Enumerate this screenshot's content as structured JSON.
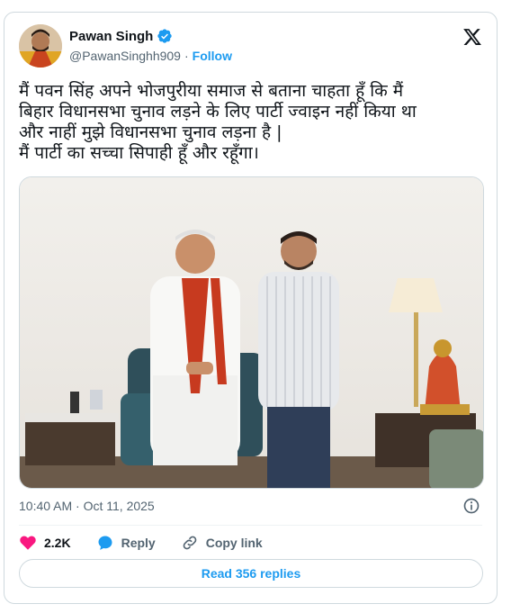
{
  "author": {
    "name": "Pawan Singh",
    "handle": "@PawanSinghh909",
    "separator": "·",
    "follow_label": "Follow"
  },
  "tweet": {
    "lines": [
      "मैं पवन सिंह अपने भोजपुरीया समाज से बताना चाहता हूँ कि मैं",
      "बिहार विधानसभा चुनाव लड़ने के लिए पार्टी ज्वाइन नहीं किया था",
      "और नाहीं मुझे विधानसभा चुनाव लड़ना है |",
      "मैं पार्टी का सच्चा सिपाही हूँ और रहूँगा।"
    ]
  },
  "meta": {
    "timestamp": "10:40 AM · Oct 11, 2025"
  },
  "actions": {
    "likes_count": "2.2K",
    "reply_label": "Reply",
    "copy_link_label": "Copy link"
  },
  "read_replies_label": "Read 356 replies",
  "colors": {
    "accent": "#1d9bf0",
    "like": "#f91880",
    "text": "#0f1419",
    "secondary": "#536471",
    "border": "#cfd9de"
  },
  "icons": [
    "verified-badge-icon",
    "x-logo-icon",
    "info-icon",
    "heart-icon",
    "reply-bubble-icon",
    "link-icon"
  ]
}
